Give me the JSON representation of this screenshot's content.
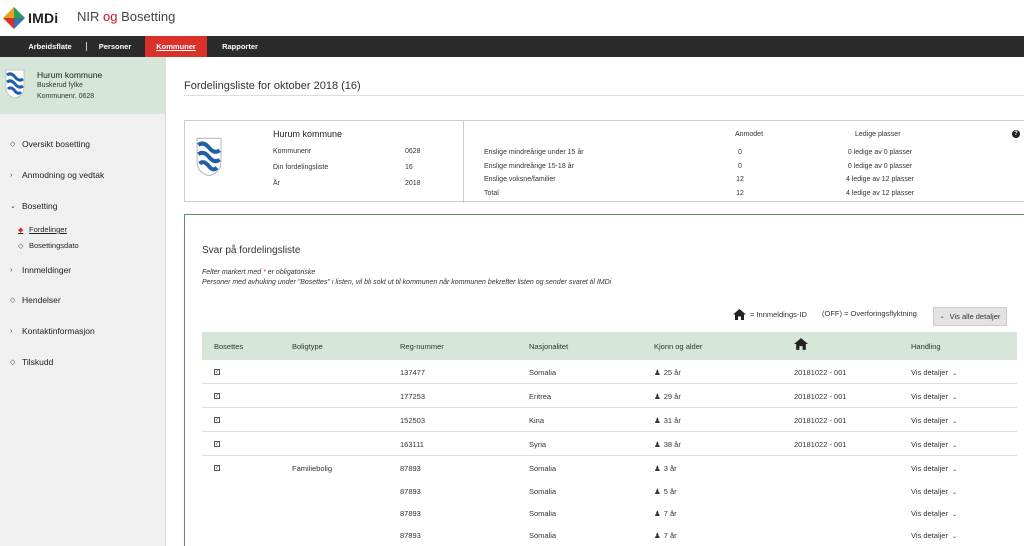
{
  "header": {
    "logo_text": "IMDi",
    "title_part1": "NIR",
    "title_og": "og",
    "title_part2": "Bosetting"
  },
  "nav": {
    "items": [
      {
        "label": "Arbeidsflate"
      },
      {
        "label": "Personer"
      },
      {
        "label": "Kommuner"
      },
      {
        "label": "Rapporter"
      }
    ],
    "active": "Kommuner"
  },
  "sidebar": {
    "municipality": {
      "name": "Hurum kommune",
      "county": "Buskerud fylke",
      "number": "Kommunenr. 0628"
    },
    "items": [
      {
        "label": "Oversikt bosetting",
        "icon": "diamond-outline-icon"
      },
      {
        "label": "Anmodning og vedtak",
        "icon": "chevron-right-icon"
      },
      {
        "label": "Bosetting",
        "icon": "chevron-down-icon"
      },
      {
        "label": "Innmeldinger",
        "icon": "chevron-right-icon"
      },
      {
        "label": "Hendelser",
        "icon": "diamond-outline-icon"
      },
      {
        "label": "Kontaktinformasjon",
        "icon": "chevron-right-icon"
      },
      {
        "label": "Tilskudd",
        "icon": "diamond-outline-icon"
      }
    ],
    "subitems": [
      {
        "label": "Fordelinger",
        "icon": "diamond-filled-icon",
        "active": true
      },
      {
        "label": "Bosettingsdato",
        "icon": "diamond-outline-icon",
        "active": false
      }
    ]
  },
  "main": {
    "page_title": "Fordelingsliste for oktober 2018 (16)",
    "info": {
      "name": "Hurum kommune",
      "fields": [
        {
          "label": "Kommunenr",
          "value": "0628"
        },
        {
          "label": "Din fordelingsliste",
          "value": "16"
        },
        {
          "label": "År",
          "value": "2018"
        }
      ],
      "header_requested": "Anmodet",
      "header_free": "Ledige plasser",
      "help": "?",
      "rows": [
        {
          "label": "Enslige mindreårige under 15 år",
          "requested": "0",
          "free": "0 ledige av 0 plasser"
        },
        {
          "label": "Enslige mindreårige 15-18 år",
          "requested": "0",
          "free": "0 ledige av 0 plasser"
        },
        {
          "label": "Enslige voksne/familier",
          "requested": "12",
          "free": "4 ledige av 12 plasser"
        },
        {
          "label": "Total",
          "requested": "12",
          "free": "4 ledige av 12 plasser"
        }
      ]
    },
    "svar": {
      "title": "Svar på fordelingsliste",
      "note1_pre": "Felter markert med",
      "note1_star": "*",
      "note1_post": "er obligatoriske",
      "note2": "Personer med avhuking under \"Bosettes\" i listen, vil bli sokt ut til kommunen når kommunen bekrefter listen og sender svaret til IMDi",
      "legend_house": "= Innmeldings-ID",
      "legend_off": "(OFF) = Overforingsflyktning",
      "show_all_label": "Vis alle detaljer"
    },
    "table": {
      "headers": [
        "Bosettes",
        "Boligtype",
        "Reg-nummer",
        "Nasjonalitet",
        "Kjonn og alder",
        "",
        "Handling"
      ],
      "rows": [
        {
          "checked": true,
          "boligtype": "",
          "reg": "137477",
          "nat": "Somalia",
          "age": "25 år",
          "id": "20181022 - 001",
          "action": "Vis detaljer"
        },
        {
          "checked": true,
          "boligtype": "",
          "reg": "177253",
          "nat": "Eritrea",
          "age": "29 år",
          "id": "20181022 - 001",
          "action": "Vis detaljer"
        },
        {
          "checked": true,
          "boligtype": "",
          "reg": "152503",
          "nat": "Kina",
          "age": "31 år",
          "id": "20181022 - 001",
          "action": "Vis detaljer"
        },
        {
          "checked": true,
          "boligtype": "",
          "reg": "163111",
          "nat": "Syria",
          "age": "38 år",
          "id": "20181022 - 001",
          "action": "Vis detaljer"
        },
        {
          "checked": true,
          "boligtype": "Familiebolig",
          "reg": "87893",
          "nat": "Somalia",
          "age": "3 år",
          "id": "",
          "action": "Vis detaljer"
        },
        {
          "checked": false,
          "boligtype": "",
          "reg": "87893",
          "nat": "Somalia",
          "age": "5 år",
          "id": "",
          "action": "Vis detaljer"
        },
        {
          "checked": false,
          "boligtype": "",
          "reg": "87893",
          "nat": "Somalia",
          "age": "7 år",
          "id": "",
          "action": "Vis detaljer"
        },
        {
          "checked": false,
          "boligtype": "",
          "reg": "87893",
          "nat": "Somalia",
          "age": "7 år",
          "id": "",
          "action": "Vis detaljer"
        }
      ]
    }
  },
  "colors": {
    "accent": "#d9322b",
    "nav_bg": "#2b2b2b",
    "green_light": "#d6e6d8",
    "green_border": "#5a8f5e"
  }
}
